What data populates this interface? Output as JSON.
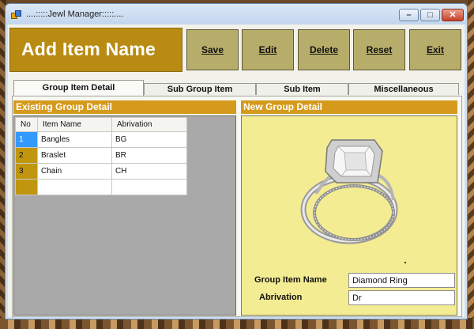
{
  "window": {
    "title": "....:::::Jewl Manager:::::...."
  },
  "header": {
    "title": "Add Item Name"
  },
  "toolbar": {
    "save_label": "Save",
    "edit_label": "Edit",
    "delete_label": "Delete",
    "reset_label": "Reset",
    "exit_label": "Exit"
  },
  "tabs": [
    {
      "label": "Group Item Detail"
    },
    {
      "label": "Sub Group Item"
    },
    {
      "label": "Sub Item"
    },
    {
      "label": "Miscellaneous"
    }
  ],
  "existing": {
    "heading": "Existing Group Detail",
    "columns": [
      "No",
      "Item Name",
      "Abrivation"
    ],
    "rows": [
      {
        "no": "1",
        "name": "Bangles",
        "abr": "BG"
      },
      {
        "no": "2",
        "name": "Braslet",
        "abr": "BR"
      },
      {
        "no": "3",
        "name": "Chain",
        "abr": "CH"
      }
    ]
  },
  "new_group": {
    "heading": "New Group Detail",
    "group_item_label": "Group Item Name",
    "group_item_value": "Diamond Ring",
    "abrivation_label": "Abrivation",
    "abrivation_value": "Dr"
  },
  "colors": {
    "accent_gold": "#b98b12",
    "section_orange": "#d59a1c",
    "form_yellow": "#f4ec93",
    "selected_row": "#3399ff"
  },
  "icons": [
    "app-icon",
    "minimize-icon",
    "maximize-icon",
    "close-icon",
    "ring-image"
  ]
}
